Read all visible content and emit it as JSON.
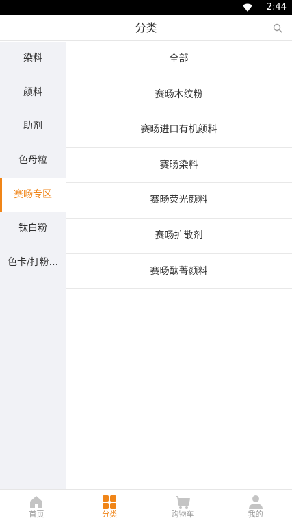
{
  "status_bar": {
    "time": "2:44",
    "wifi_icon": "wifi-icon"
  },
  "header": {
    "title": "分类",
    "search_icon": "search-icon"
  },
  "sidebar": {
    "items": [
      {
        "label": "染料"
      },
      {
        "label": "颜料"
      },
      {
        "label": "助剂"
      },
      {
        "label": "色母粒"
      },
      {
        "label": "赛旸专区",
        "active": true
      },
      {
        "label": "钛白粉"
      },
      {
        "label": "色卡/打粉..."
      }
    ]
  },
  "main": {
    "items": [
      {
        "label": "全部"
      },
      {
        "label": "赛旸木纹粉"
      },
      {
        "label": "赛旸进口有机颜料"
      },
      {
        "label": "赛旸染料"
      },
      {
        "label": "赛旸荧光颜料"
      },
      {
        "label": "赛旸扩散剂"
      },
      {
        "label": "赛旸酞菁颜料"
      }
    ]
  },
  "tabbar": {
    "tabs": [
      {
        "label": "首页",
        "icon": "home-icon"
      },
      {
        "label": "分类",
        "icon": "category-grid-icon",
        "active": true
      },
      {
        "label": "购物车",
        "icon": "cart-icon"
      },
      {
        "label": "我的",
        "icon": "user-icon"
      }
    ]
  },
  "colors": {
    "accent": "#f08518",
    "sidebar_bg": "#f1f2f6",
    "inactive": "#c4c4c4"
  }
}
